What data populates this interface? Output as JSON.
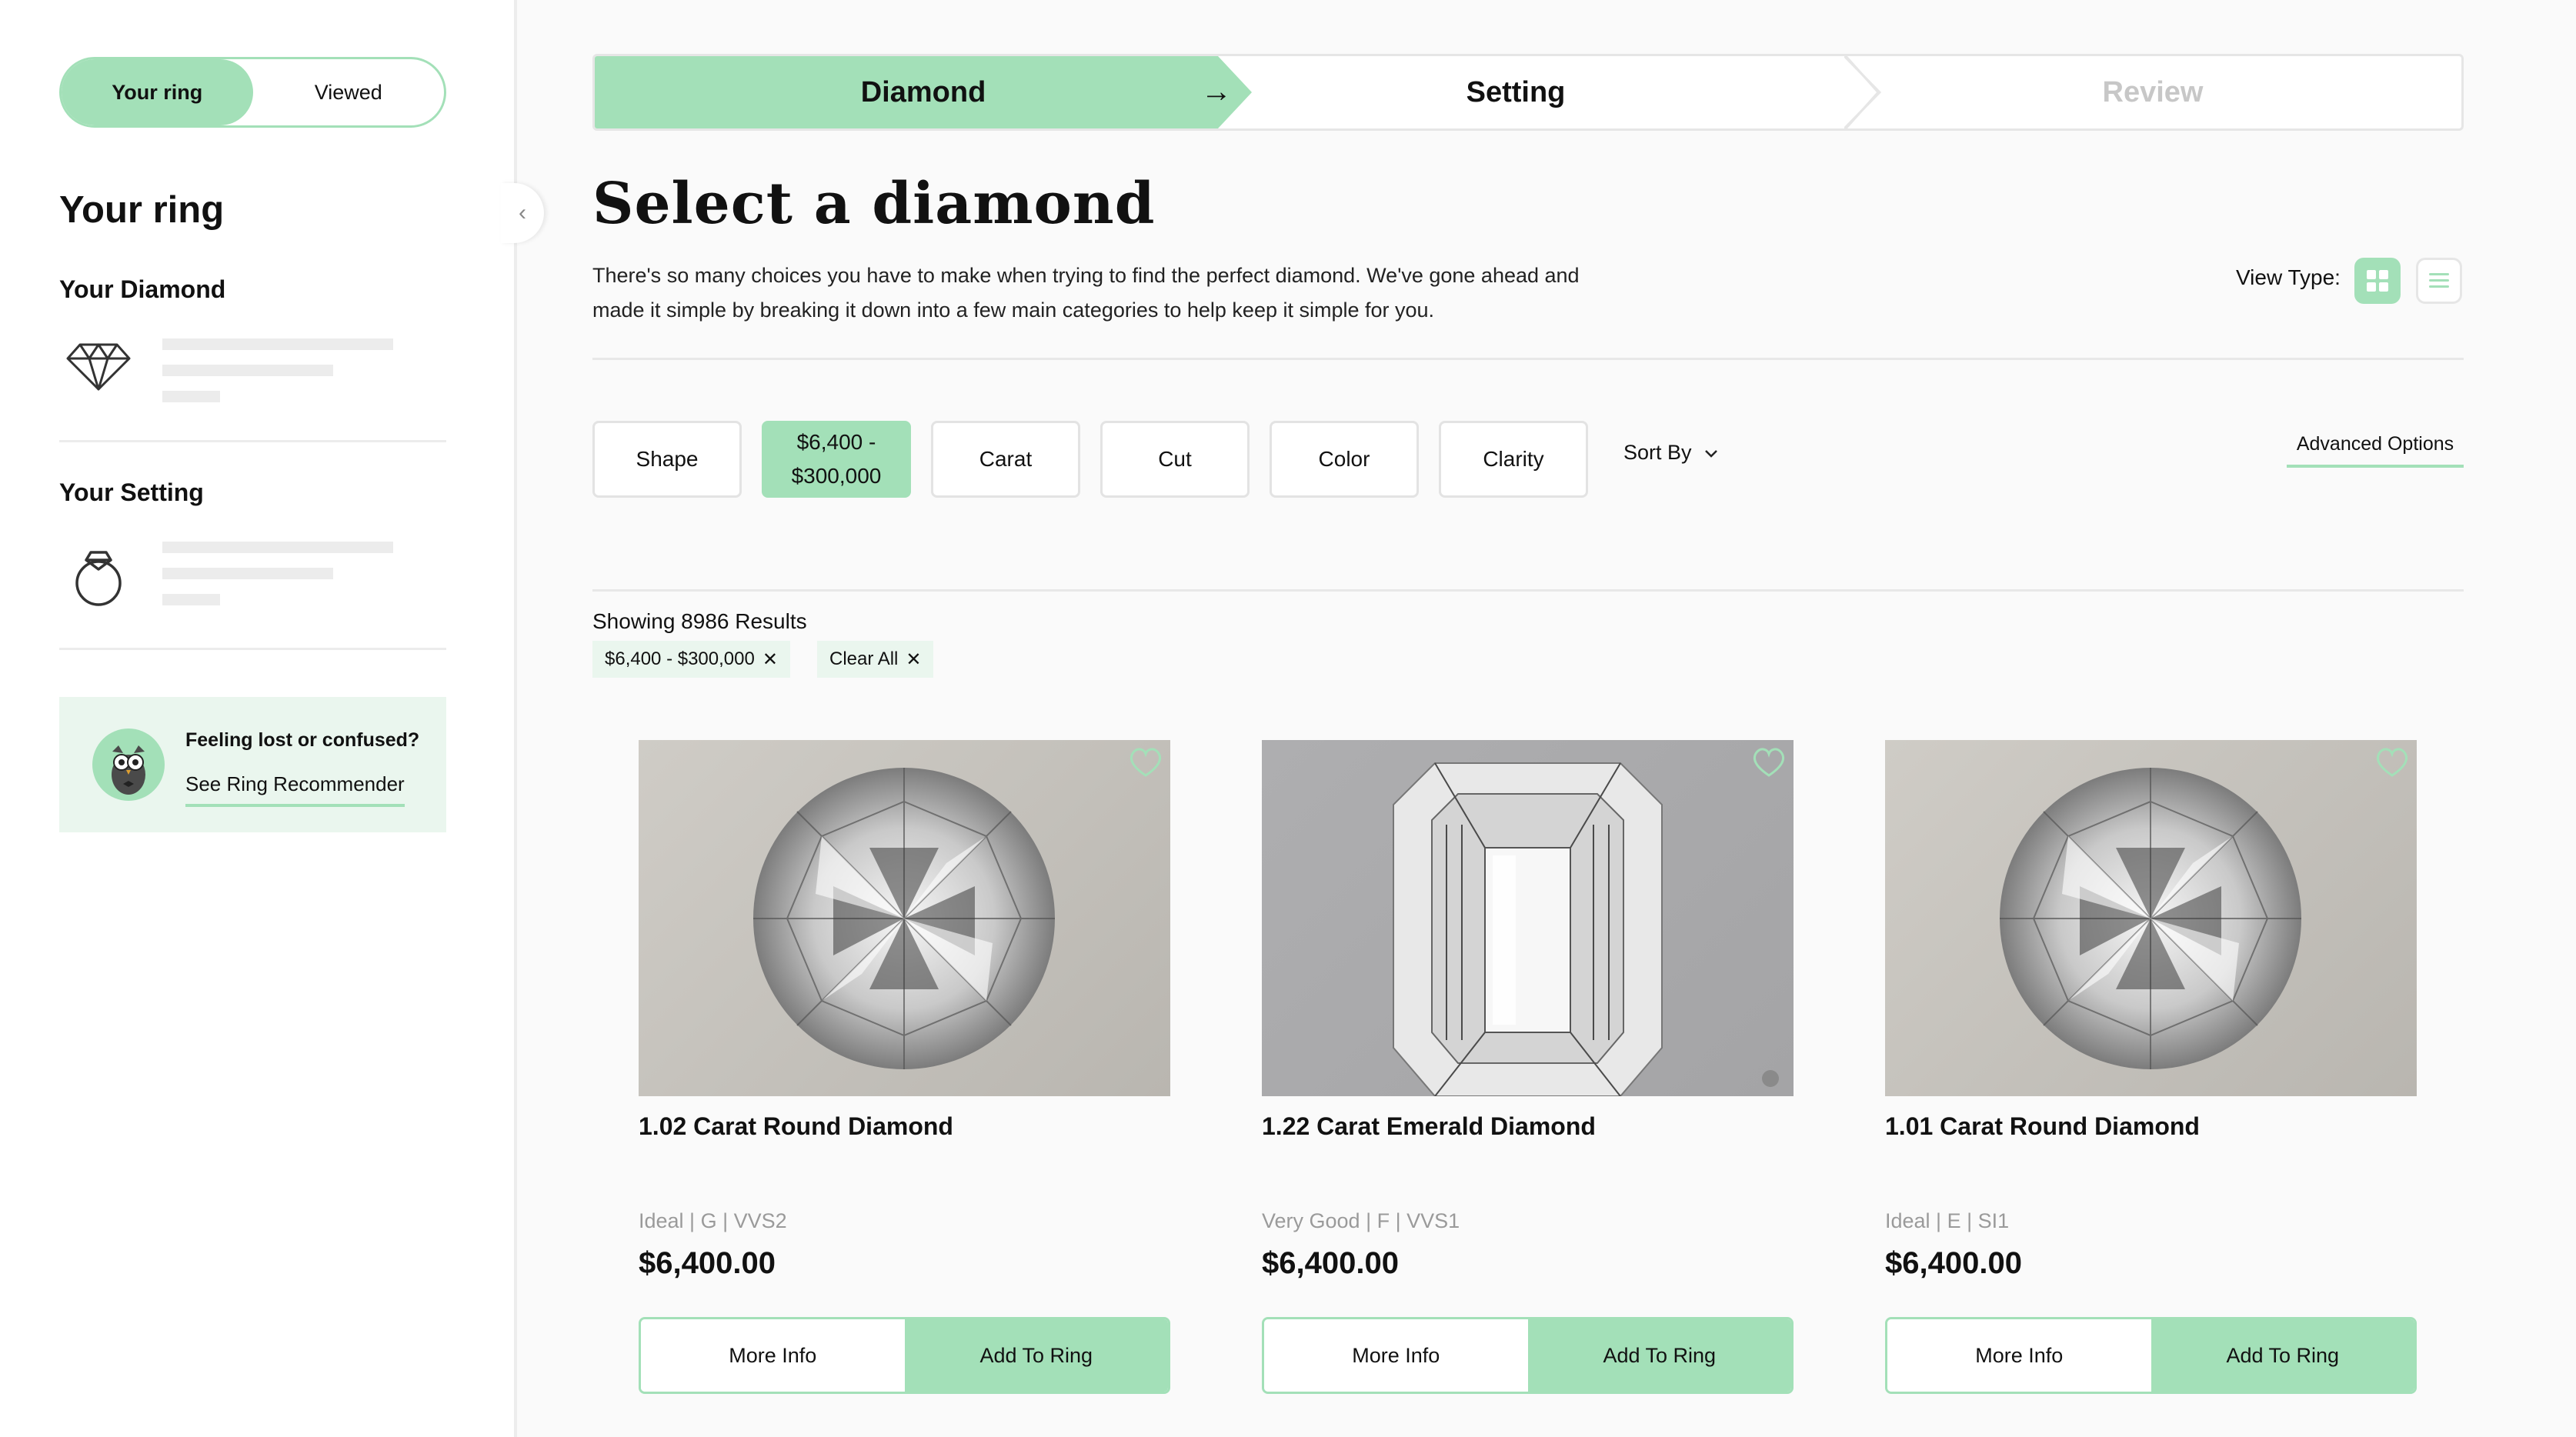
{
  "sidebar": {
    "toggle": {
      "active": "Your ring",
      "other": "Viewed"
    },
    "heading": "Your ring",
    "diamond_label": "Your Diamond",
    "setting_label": "Your Setting",
    "help": {
      "title": "Feeling lost or confused?",
      "link": "See Ring Recommender"
    }
  },
  "steps": {
    "diamond": "Diamond",
    "setting": "Setting",
    "review": "Review"
  },
  "page": {
    "title": "Select a diamond",
    "description": "There's so many choices you have to make when trying to find the perfect diamond. We've gone ahead and made it simple by breaking it down into a few main categories to help keep it simple for you.",
    "view_type_label": "View Type:"
  },
  "filters": {
    "shape": "Shape",
    "price_line1": "$6,400 -",
    "price_line2": "$300,000",
    "carat": "Carat",
    "cut": "Cut",
    "color": "Color",
    "clarity": "Clarity",
    "sort_by": "Sort By",
    "advanced": "Advanced Options"
  },
  "results": {
    "count_text": "Showing 8986 Results",
    "chips": {
      "price": "$6,400 - $300,000",
      "clear": "Clear All"
    }
  },
  "products": [
    {
      "title": "1.02 Carat Round Diamond",
      "specs": "Ideal | G | VVS2",
      "price": "$6,400.00",
      "more": "More Info",
      "add": "Add To Ring",
      "shape": "round"
    },
    {
      "title": "1.22 Carat Emerald Diamond",
      "specs": "Very Good | F | VVS1",
      "price": "$6,400.00",
      "more": "More Info",
      "add": "Add To Ring",
      "shape": "emerald"
    },
    {
      "title": "1.01 Carat Round Diamond",
      "specs": "Ideal | E | SI1",
      "price": "$6,400.00",
      "more": "More Info",
      "add": "Add To Ring",
      "shape": "round"
    }
  ],
  "colors": {
    "accent": "#a3e0b8",
    "accent_light": "#eaf6ee",
    "border": "#e3e3e3"
  },
  "icons": [
    "diamond-icon",
    "ring-icon",
    "owl-avatar",
    "arrow-right-icon",
    "chevron-left-icon",
    "grid-view-icon",
    "list-view-icon",
    "chevron-down-icon",
    "close-icon",
    "heart-icon"
  ]
}
